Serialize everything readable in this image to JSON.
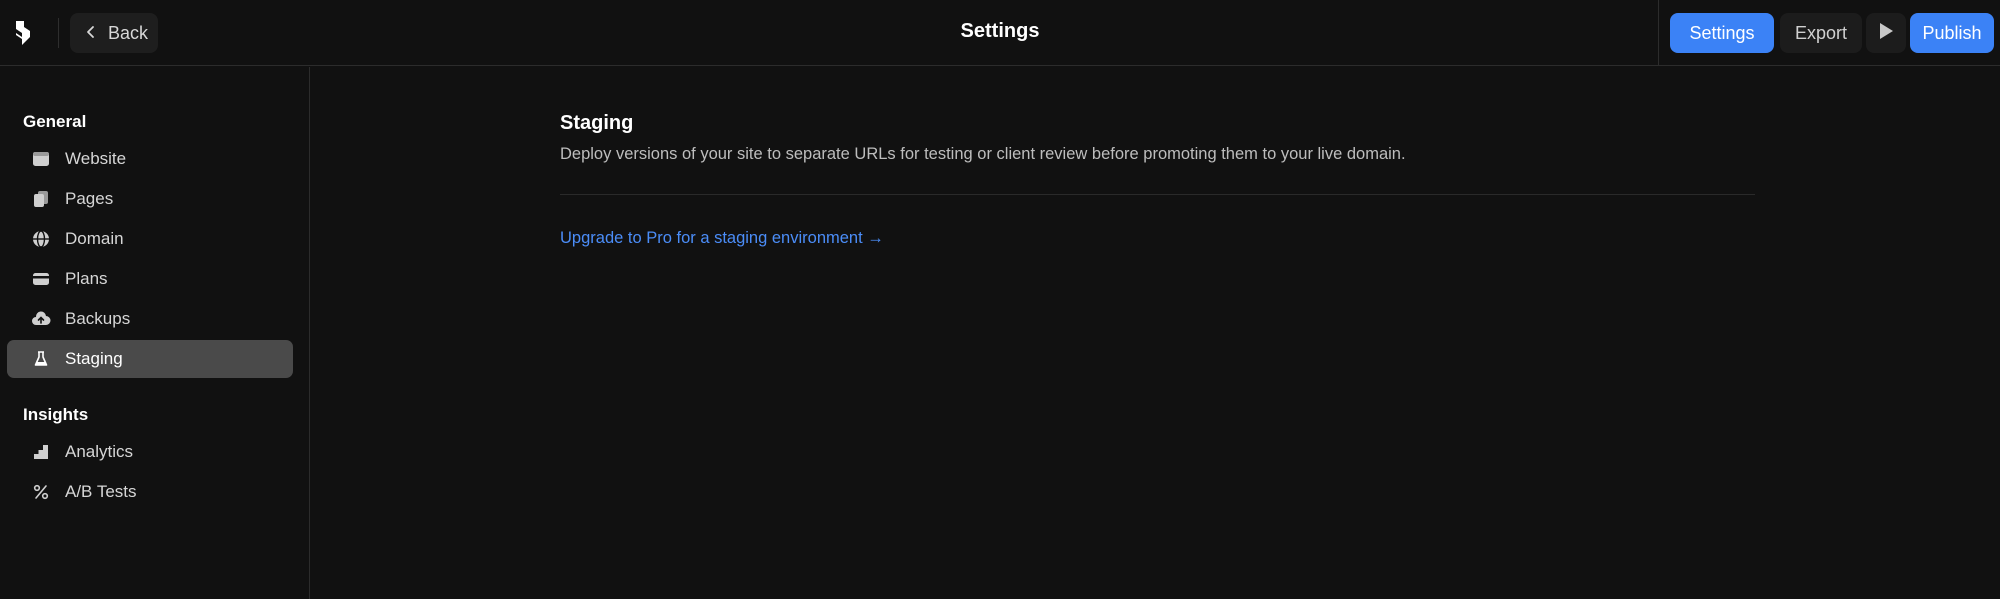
{
  "header": {
    "back_label": "Back",
    "title": "Settings",
    "settings_label": "Settings",
    "export_label": "Export",
    "publish_label": "Publish"
  },
  "sidebar": {
    "sections": [
      {
        "label": "General",
        "items": [
          {
            "label": "Website",
            "icon": "browser-window-icon"
          },
          {
            "label": "Pages",
            "icon": "pages-icon"
          },
          {
            "label": "Domain",
            "icon": "globe-icon"
          },
          {
            "label": "Plans",
            "icon": "credit-card-icon"
          },
          {
            "label": "Backups",
            "icon": "cloud-upload-icon"
          },
          {
            "label": "Staging",
            "icon": "flask-icon",
            "active": true
          }
        ]
      },
      {
        "label": "Insights",
        "items": [
          {
            "label": "Analytics",
            "icon": "bar-chart-icon"
          },
          {
            "label": "A/B Tests",
            "icon": "percent-icon"
          }
        ]
      }
    ]
  },
  "main": {
    "title": "Staging",
    "description": "Deploy versions of your site to separate URLs for testing or client review before promoting them to your live domain.",
    "upgrade_link": "Upgrade to Pro for a staging environment →"
  },
  "colors": {
    "accent": "#3b82f6",
    "background": "#111111",
    "active_item": "#4a4a4a",
    "link": "#4b8df8"
  }
}
